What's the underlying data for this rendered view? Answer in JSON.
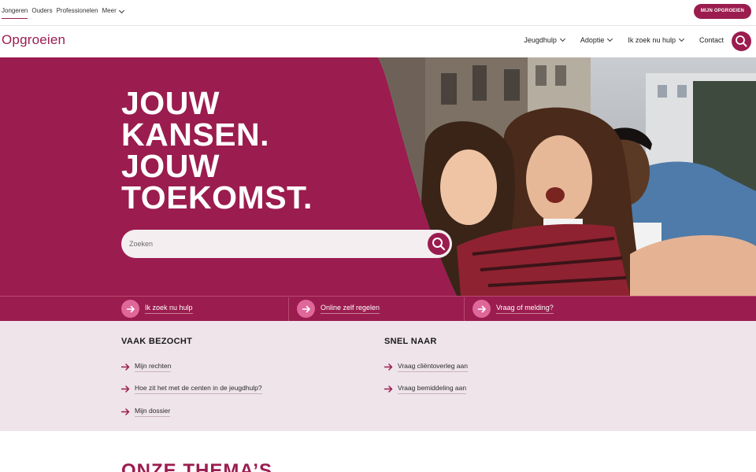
{
  "topbar": {
    "audiences": [
      "Jongeren",
      "Ouders",
      "Professionelen"
    ],
    "more_label": "Meer",
    "account_button": "MIJN OPGROEIEN"
  },
  "nav": {
    "logo": "Opgroeien",
    "items": [
      {
        "label": "Jeugdhulp"
      },
      {
        "label": "Adoptie"
      },
      {
        "label": "Ik zoek nu hulp"
      }
    ],
    "contact_label": "Contact"
  },
  "hero": {
    "headline": [
      "JOUW",
      "KANSEN.",
      "JOUW",
      "TOEKOMST."
    ],
    "search": {
      "placeholder": "Zoeken",
      "value": ""
    }
  },
  "quick_links": [
    {
      "label": "Ik zoek nu hulp"
    },
    {
      "label": "Online zelf regelen"
    },
    {
      "label": "Vraag of melding?"
    }
  ],
  "vaak_bezocht": {
    "title": "VAAK BEZOCHT",
    "links": [
      "Mijn rechten",
      "Hoe zit het met de centen in de jeugdhulp?",
      "Mijn dossier"
    ]
  },
  "snel_naar": {
    "title": "SNEL NAAR",
    "links": [
      "Vraag cliëntoverleg aan",
      "Vraag bemiddeling aan"
    ]
  },
  "themes": {
    "title": "ONZE THEMA’S"
  },
  "colors": {
    "brand": "#9b1c4e",
    "accent": "#e0679a",
    "light_bg": "#efe4ea"
  },
  "icons": [
    "chevron-down-icon",
    "search-icon",
    "arrow-right-icon"
  ]
}
